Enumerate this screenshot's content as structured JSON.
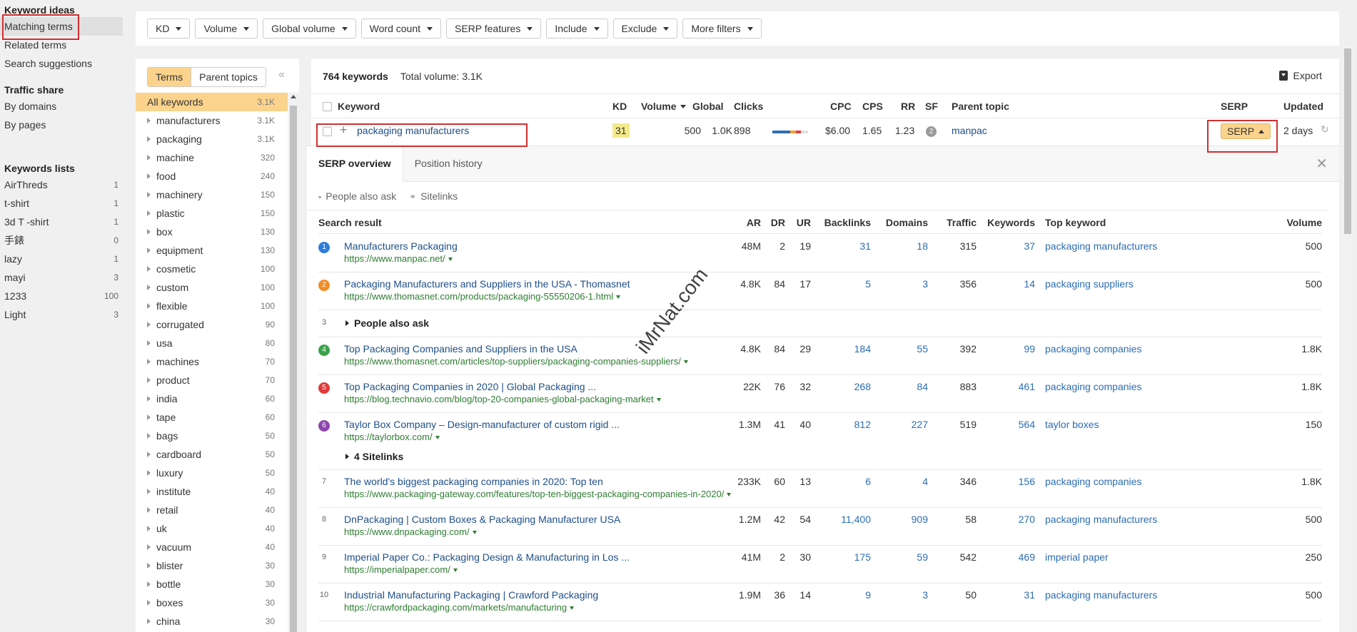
{
  "sidebar": {
    "sections": [
      {
        "heading": "Keyword ideas",
        "items": [
          {
            "label": "Matching terms",
            "active": true
          },
          {
            "label": "Related terms"
          },
          {
            "label": "Search suggestions"
          }
        ]
      },
      {
        "heading": "Traffic share",
        "items": [
          {
            "label": "By domains"
          },
          {
            "label": "By pages"
          }
        ]
      },
      {
        "heading": "Keywords lists",
        "items": [
          {
            "label": "AirThreds",
            "count": "1"
          },
          {
            "label": "t-shirt",
            "count": "1"
          },
          {
            "label": "3d T -shirt",
            "count": "1"
          },
          {
            "label": "手錶",
            "count": "0"
          },
          {
            "label": "lazy",
            "count": "1"
          },
          {
            "label": "mayi",
            "count": "3"
          },
          {
            "label": "1233",
            "count": "100"
          },
          {
            "label": "Light",
            "count": "3"
          }
        ]
      }
    ]
  },
  "filters": [
    "KD",
    "Volume",
    "Global volume",
    "Word count",
    "SERP features",
    "Include",
    "Exclude",
    "More filters"
  ],
  "terms_panel": {
    "toggle": [
      "Terms",
      "Parent topics"
    ],
    "collapse_icon": "«",
    "items": [
      {
        "name": "All keywords",
        "count": "3.1K",
        "selected": true
      },
      {
        "name": "manufacturers",
        "count": "3.1K"
      },
      {
        "name": "packaging",
        "count": "3.1K"
      },
      {
        "name": "machine",
        "count": "320"
      },
      {
        "name": "food",
        "count": "240"
      },
      {
        "name": "machinery",
        "count": "150"
      },
      {
        "name": "plastic",
        "count": "150"
      },
      {
        "name": "box",
        "count": "130"
      },
      {
        "name": "equipment",
        "count": "130"
      },
      {
        "name": "cosmetic",
        "count": "100"
      },
      {
        "name": "custom",
        "count": "100"
      },
      {
        "name": "flexible",
        "count": "100"
      },
      {
        "name": "corrugated",
        "count": "90"
      },
      {
        "name": "usa",
        "count": "80"
      },
      {
        "name": "machines",
        "count": "70"
      },
      {
        "name": "product",
        "count": "70"
      },
      {
        "name": "india",
        "count": "60"
      },
      {
        "name": "tape",
        "count": "60"
      },
      {
        "name": "bags",
        "count": "50"
      },
      {
        "name": "cardboard",
        "count": "50"
      },
      {
        "name": "luxury",
        "count": "50"
      },
      {
        "name": "institute",
        "count": "40"
      },
      {
        "name": "retail",
        "count": "40"
      },
      {
        "name": "uk",
        "count": "40"
      },
      {
        "name": "vacuum",
        "count": "40"
      },
      {
        "name": "blister",
        "count": "30"
      },
      {
        "name": "bottle",
        "count": "30"
      },
      {
        "name": "boxes",
        "count": "30"
      },
      {
        "name": "china",
        "count": "30"
      }
    ]
  },
  "main": {
    "keyword_count": "764 keywords",
    "total_volume": "Total volume: 3.1K",
    "export_label": "Export",
    "columns": {
      "keyword": "Keyword",
      "kd": "KD",
      "volume": "Volume",
      "global": "Global",
      "clicks": "Clicks",
      "cpc": "CPC",
      "cps": "CPS",
      "rr": "RR",
      "sf": "SF",
      "parent_topic": "Parent topic",
      "serp": "SERP",
      "updated": "Updated"
    },
    "row": {
      "keyword": "packaging manufacturers",
      "kd": "31",
      "volume": "500",
      "global": "1.0K",
      "clicks": "898",
      "clicks_bar": [
        {
          "color": "#2f6db5",
          "share": 0.5
        },
        {
          "color": "#f0a030",
          "share": 0.15
        },
        {
          "color": "#e04040",
          "share": 0.15
        },
        {
          "color": "#e0e0e0",
          "share": 0.2
        }
      ],
      "cpc": "$6.00",
      "cps": "1.65",
      "rr": "1.23",
      "sf": "2",
      "parent_topic": "manpac",
      "serp_button": "SERP",
      "updated": "2 days"
    }
  },
  "serp": {
    "tabs": [
      "SERP overview",
      "Position history"
    ],
    "features": [
      "People also ask",
      "Sitelinks"
    ],
    "columns": {
      "result": "Search result",
      "ar": "AR",
      "dr": "DR",
      "ur": "UR",
      "backlinks": "Backlinks",
      "domains": "Domains",
      "traffic": "Traffic",
      "keywords": "Keywords",
      "top_keyword": "Top keyword",
      "volume": "Volume"
    },
    "results": [
      {
        "pos": "1",
        "color": "#2f7ed8",
        "title": "Manufacturers Packaging",
        "url": "https://www.manpac.net/",
        "ar": "48M",
        "dr": "2",
        "ur": "19",
        "backlinks": "31",
        "domains": "18",
        "traffic": "315",
        "keywords": "37",
        "top_keyword": "packaging manufacturers",
        "volume": "500"
      },
      {
        "pos": "2",
        "color": "#f28c28",
        "title": "Packaging Manufacturers and Suppliers in the USA - Thomasnet",
        "url": "https://www.thomasnet.com/products/packaging-55550206-1.html",
        "ar": "4.8K",
        "dr": "84",
        "ur": "17",
        "backlinks": "5",
        "domains": "3",
        "traffic": "356",
        "keywords": "14",
        "top_keyword": "packaging suppliers",
        "volume": "500"
      },
      {
        "pos": "3",
        "expander": "People also ask"
      },
      {
        "pos": "4",
        "color": "#3aa34a",
        "title": "Top Packaging Companies and Suppliers in the USA",
        "url": "https://www.thomasnet.com/articles/top-suppliers/packaging-companies-suppliers/",
        "ar": "4.8K",
        "dr": "84",
        "ur": "29",
        "backlinks": "184",
        "domains": "55",
        "traffic": "392",
        "keywords": "99",
        "top_keyword": "packaging companies",
        "volume": "1.8K"
      },
      {
        "pos": "5",
        "color": "#e23b3b",
        "title": "Top Packaging Companies in 2020 | Global Packaging ...",
        "url": "https://blog.technavio.com/blog/top-20-companies-global-packaging-market",
        "ar": "22K",
        "dr": "76",
        "ur": "32",
        "backlinks": "268",
        "domains": "84",
        "traffic": "883",
        "keywords": "461",
        "top_keyword": "packaging companies",
        "volume": "1.8K"
      },
      {
        "pos": "6",
        "color": "#8e44ad",
        "title": "Taylor Box Company – Design-manufacturer of custom rigid ...",
        "url": "https://taylorbox.com/",
        "ar": "1.3M",
        "dr": "41",
        "ur": "40",
        "backlinks": "812",
        "domains": "227",
        "traffic": "519",
        "keywords": "564",
        "top_keyword": "taylor boxes",
        "volume": "150",
        "sitelinks": "4 Sitelinks"
      },
      {
        "pos": "7",
        "title": "The world's biggest packaging companies in 2020: Top ten",
        "url": "https://www.packaging-gateway.com/features/top-ten-biggest-packaging-companies-in-2020/",
        "ar": "233K",
        "dr": "60",
        "ur": "13",
        "backlinks": "6",
        "domains": "4",
        "traffic": "346",
        "keywords": "156",
        "top_keyword": "packaging companies",
        "volume": "1.8K"
      },
      {
        "pos": "8",
        "title": "DnPackaging | Custom Boxes & Packaging Manufacturer USA",
        "url": "https://www.dnpackaging.com/",
        "ar": "1.2M",
        "dr": "42",
        "ur": "54",
        "backlinks": "11,400",
        "domains": "909",
        "traffic": "58",
        "keywords": "270",
        "top_keyword": "packaging manufacturers",
        "volume": "500"
      },
      {
        "pos": "9",
        "title": "Imperial Paper Co.: Packaging Design & Manufacturing in Los ...",
        "url": "https://imperialpaper.com/",
        "ar": "41M",
        "dr": "2",
        "ur": "30",
        "backlinks": "175",
        "domains": "59",
        "traffic": "542",
        "keywords": "469",
        "top_keyword": "imperial paper",
        "volume": "250"
      },
      {
        "pos": "10",
        "title": "Industrial Manufacturing Packaging | Crawford Packaging",
        "url": "https://crawfordpackaging.com/markets/manufacturing",
        "ar": "1.9M",
        "dr": "36",
        "ur": "14",
        "backlinks": "9",
        "domains": "3",
        "traffic": "50",
        "keywords": "31",
        "top_keyword": "packaging manufacturers",
        "volume": "500"
      }
    ]
  },
  "watermark": "iMrNat.com"
}
